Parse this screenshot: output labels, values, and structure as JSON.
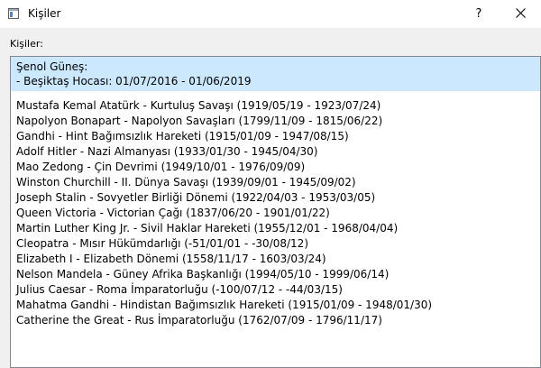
{
  "window": {
    "title": "Kişiler",
    "help_label": "?"
  },
  "list_label": "Kişiler:",
  "selected_item": {
    "line1": "Şenol Güneş:",
    "line2": "- Beşiktaş Hocası: 01/07/2016 - 01/06/2019"
  },
  "items": [
    "Mustafa Kemal Atatürk - Kurtuluş Savaşı (1919/05/19 - 1923/07/24)",
    "Napolyon Bonapart - Napolyon Savaşları (1799/11/09 - 1815/06/22)",
    "Gandhi - Hint Bağımsızlık Hareketi (1915/01/09 - 1947/08/15)",
    "Adolf Hitler - Nazi Almanyası (1933/01/30 - 1945/04/30)",
    "Mao Zedong - Çin Devrimi (1949/10/01 - 1976/09/09)",
    "Winston Churchill - II. Dünya Savaşı (1939/09/01 - 1945/09/02)",
    "Joseph Stalin - Sovyetler Birliği Dönemi (1922/04/03 - 1953/03/05)",
    "Queen Victoria - Victorian Çağı (1837/06/20 - 1901/01/22)",
    "Martin Luther King Jr. - Sivil Haklar Hareketi (1955/12/01 - 1968/04/04)",
    "Cleopatra - Mısır Hükümdarlığı (-51/01/01 - -30/08/12)",
    "Elizabeth I - Elizabeth Dönemi (1558/11/17 - 1603/03/24)",
    "Nelson Mandela - Güney Afrika Başkanlığı (1994/05/10 - 1999/06/14)",
    "Julius Caesar - Roma İmparatorluğu (-100/07/12 - -44/03/15)",
    "Mahatma Gandhi - Hindistan Bağımsızlık Hareketi (1915/01/09 - 1948/01/30)",
    "Catherine the Great - Rus İmparatorluğu (1762/07/09 - 1796/11/17)"
  ]
}
